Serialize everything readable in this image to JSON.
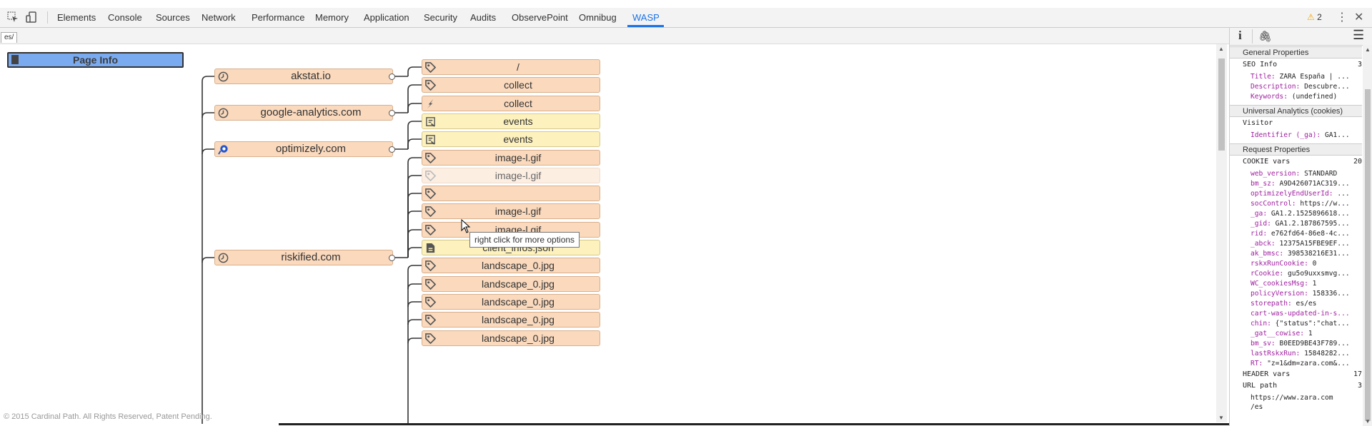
{
  "toolbar": {
    "tabs": [
      "Elements",
      "Console",
      "Sources",
      "Network",
      "Performance",
      "Memory",
      "Application",
      "Security",
      "Audits",
      "ObservePoint",
      "Omnibug",
      "WASP"
    ],
    "active_tab": "WASP",
    "warning_count": "2",
    "accent": "#1a73e8",
    "icons": [
      "inspect-icon",
      "device-toolbar-icon",
      "warning-icon",
      "more-options-icon",
      "close-icon"
    ]
  },
  "subbar": {
    "tab": "es/"
  },
  "graph": {
    "page_info": "Page Info",
    "domains": [
      {
        "label": "akstat.io",
        "icon": "clock-icon"
      },
      {
        "label": "google-analytics.com",
        "icon": "clock-icon"
      },
      {
        "label": "optimizely.com",
        "icon": "optimizely-icon"
      },
      {
        "label": "riskified.com",
        "icon": "clock-icon"
      }
    ],
    "requests": [
      {
        "label": "/",
        "type": "tag"
      },
      {
        "label": "collect",
        "type": "tag"
      },
      {
        "label": "collect",
        "type": "bolt"
      },
      {
        "label": "events",
        "type": "script"
      },
      {
        "label": "events",
        "type": "script"
      },
      {
        "label": "image-l.gif",
        "type": "tag"
      },
      {
        "label": "image-l.gif",
        "type": "tag-faded"
      },
      {
        "label": "",
        "type": "tag"
      },
      {
        "label": "image-l.gif",
        "type": "tag"
      },
      {
        "label": "image-l.gif",
        "type": "tag"
      },
      {
        "label": "client_infos.json",
        "type": "json"
      },
      {
        "label": "landscape_0.jpg",
        "type": "tag"
      },
      {
        "label": "landscape_0.jpg",
        "type": "tag"
      },
      {
        "label": "landscape_0.jpg",
        "type": "tag"
      },
      {
        "label": "landscape_0.jpg",
        "type": "tag"
      },
      {
        "label": "landscape_0.jpg",
        "type": "tag"
      }
    ],
    "tooltip": "right click for more options",
    "colors": {
      "domain": "#fad9bd",
      "request": "#fad9bd",
      "yellow": "#fdf1bd",
      "page_info": "#7aaaf0"
    }
  },
  "footer": "© 2015 Cardinal Path. All Rights Reserved, Patent Pending.",
  "sidebar": {
    "sections": {
      "general": "General Properties",
      "ua": "Universal Analytics (cookies)",
      "request": "Request Properties"
    },
    "seo": {
      "title": "SEO Info",
      "count": "3",
      "items": [
        {
          "k": "Title:",
          "v": "ZARA España | ..."
        },
        {
          "k": "Description:",
          "v": "Descubre..."
        },
        {
          "k": "Keywords:",
          "v": "(undefined)"
        }
      ]
    },
    "visitor": {
      "title": "Visitor",
      "items": [
        {
          "k": "Identifier (_ga):",
          "v": "GA1..."
        }
      ]
    },
    "cookie": {
      "title": "COOKIE vars",
      "count": "20",
      "items": [
        {
          "k": "web_version:",
          "v": "STANDARD"
        },
        {
          "k": "bm_sz:",
          "v": "A9D426071AC319..."
        },
        {
          "k": "optimizelyEndUserId:",
          "v": "..."
        },
        {
          "k": "socControl:",
          "v": "https://w..."
        },
        {
          "k": "_ga:",
          "v": "GA1.2.1525896618..."
        },
        {
          "k": "_gid:",
          "v": "GA1.2.187867595..."
        },
        {
          "k": "rid:",
          "v": "e762fd64-86e8-4c..."
        },
        {
          "k": "_abck:",
          "v": "12375A15FBE9EF..."
        },
        {
          "k": "ak_bmsc:",
          "v": "398538216E31..."
        },
        {
          "k": "rskxRunCookie:",
          "v": "0"
        },
        {
          "k": "rCookie:",
          "v": "gu5o9uxxsmvg..."
        },
        {
          "k": "WC_cookiesMsg:",
          "v": "1"
        },
        {
          "k": "policyVersion:",
          "v": "158336..."
        },
        {
          "k": "storepath:",
          "v": "es/es"
        },
        {
          "k": "cart-was-updated-in-s...",
          "v": ""
        },
        {
          "k": "chin:",
          "v": "{\"status\":\"chat..."
        },
        {
          "k": "_gat__cowise:",
          "v": "1"
        },
        {
          "k": "bm_sv:",
          "v": "B0EED9BE43F789..."
        },
        {
          "k": "lastRskxRun:",
          "v": "15848282..."
        },
        {
          "k": "RT:",
          "v": "\"z=1&dm=zara.com&..."
        }
      ]
    },
    "header": {
      "title": "HEADER vars",
      "count": "17"
    },
    "url": {
      "title": "URL path",
      "count": "3",
      "items": [
        {
          "k": "",
          "v": "https://www.zara.com"
        },
        {
          "k": "",
          "v": "/es"
        }
      ]
    }
  }
}
